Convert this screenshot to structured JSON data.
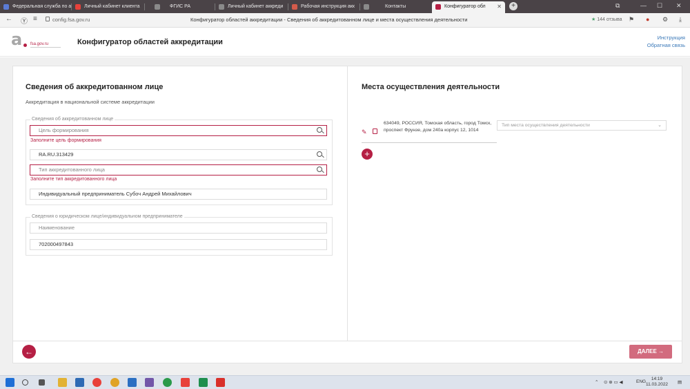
{
  "browser": {
    "tabs": [
      {
        "label": "Федеральная служба по а",
        "icon": "globe-icon",
        "color": "#5b7bd5"
      },
      {
        "label": "Личный кабинет клиента",
        "icon": "yandex-icon",
        "color": "#e8413a"
      },
      {
        "label": "ФГИС РА",
        "icon": "page-icon",
        "color": "#8a8a8a"
      },
      {
        "label": "Личный кабинет аккреди",
        "icon": "page-icon",
        "color": "#8a8a8a"
      },
      {
        "label": "Рабочая инструкция акк",
        "icon": "doc-icon",
        "color": "#d45b4b"
      },
      {
        "label": "Контакты",
        "icon": "page-icon",
        "color": "#8a8a8a"
      },
      {
        "label": "Конфигуратор обл",
        "icon": "fsa-icon",
        "color": "#b51f44"
      }
    ],
    "url": "config.fsa.gov.ru",
    "page_title": "Конфигуратор областей аккредитации - Сведения об аккредитованном лице и места осуществления деятельности",
    "reviews": "144 отзыва"
  },
  "header": {
    "logo_text": "fsa.gov.ru",
    "app_title": "Конфигуратор областей аккредитации",
    "link_instruction": "Инструкция",
    "link_feedback": "Обратная связь"
  },
  "left": {
    "title": "Сведения об аккредитованном лице",
    "subtitle": "Аккредитация в национальной системе аккредитации",
    "group1": {
      "legend": "Сведения об аккредитованном лице",
      "purpose_placeholder": "Цель формирования",
      "purpose_error": "Заполните цель формирования",
      "reg_number": "RA.RU.313429",
      "type_placeholder": "Тип аккредитованного лица",
      "type_error": "Заполните тип аккредитованного лица",
      "name": "Индивидуальный предприниматель Субоч Андрей Михайлович"
    },
    "group2": {
      "legend": "Сведения о юридическом лице/индивидуальном предпринимателе",
      "name_placeholder": "Наименование",
      "inn": "702000497843"
    }
  },
  "right": {
    "title": "Места осуществления деятельности",
    "address": "634049, РОССИЯ, Томская область, город Томск, проспект Фрунзе, дом 240а корпус 12, 1014",
    "type_placeholder": "Тип места осуществления деятельности"
  },
  "footer": {
    "next_label": "ДАЛЕЕ"
  },
  "taskbar": {
    "lang": "ENG",
    "time": "14:19",
    "date": "11.03.2022"
  },
  "colors": {
    "accent": "#b51f44",
    "next_button": "#d26b7e",
    "link": "#3a78b8"
  }
}
